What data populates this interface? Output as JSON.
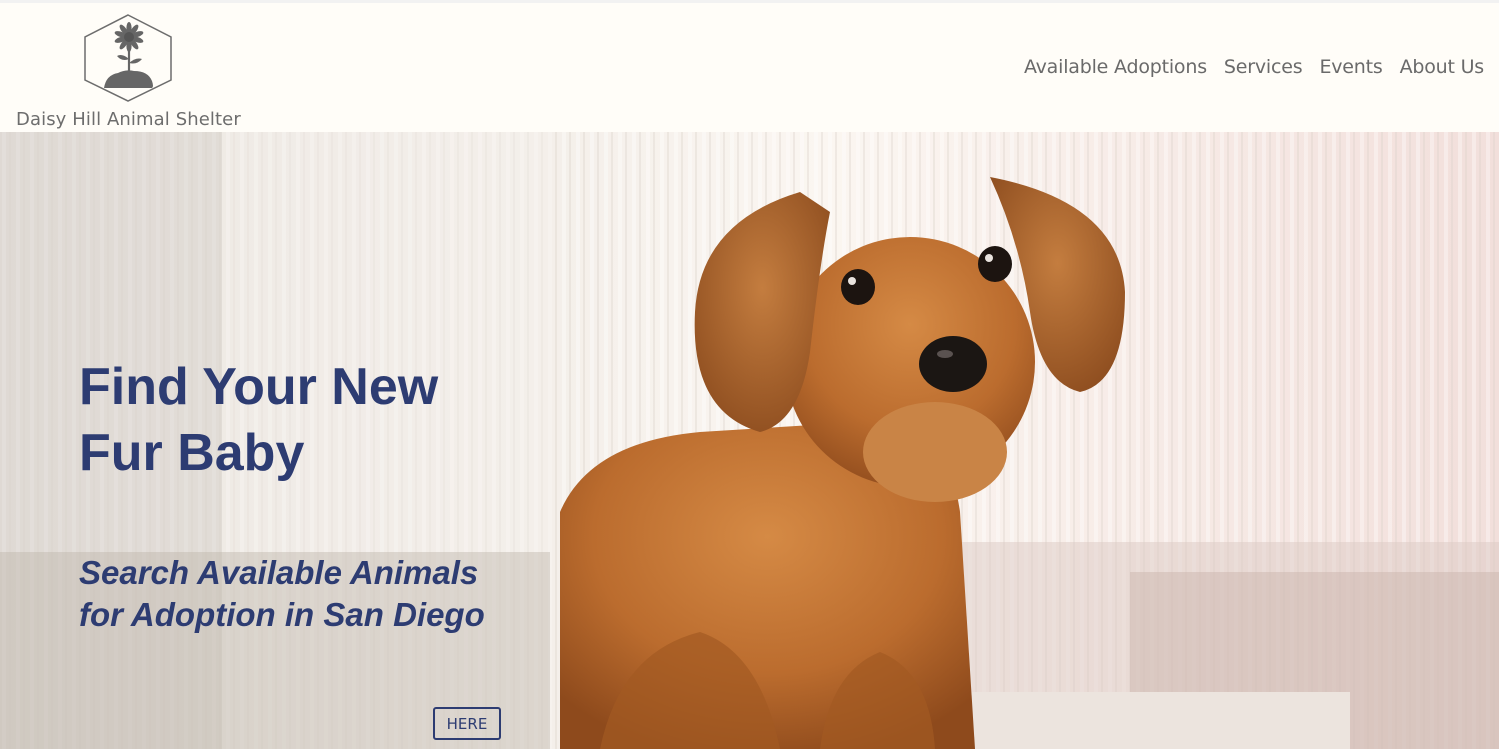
{
  "brand": {
    "name": "Daisy Hill Animal Shelter",
    "logo_icon": "sunflower-hexagon-icon"
  },
  "nav": {
    "items": [
      {
        "label": "Available Adoptions"
      },
      {
        "label": "Services"
      },
      {
        "label": "Events"
      },
      {
        "label": "About Us"
      }
    ]
  },
  "hero": {
    "title": "Find Your New Fur Baby",
    "subtitle": "Search Available Animals for Adoption in San Diego",
    "button_label": "HERE",
    "image": "dachshund-puppy-photo"
  },
  "colors": {
    "accent": "#2d3c72",
    "nav_text": "#6a6a6a",
    "header_bg": "#fffdf8"
  }
}
